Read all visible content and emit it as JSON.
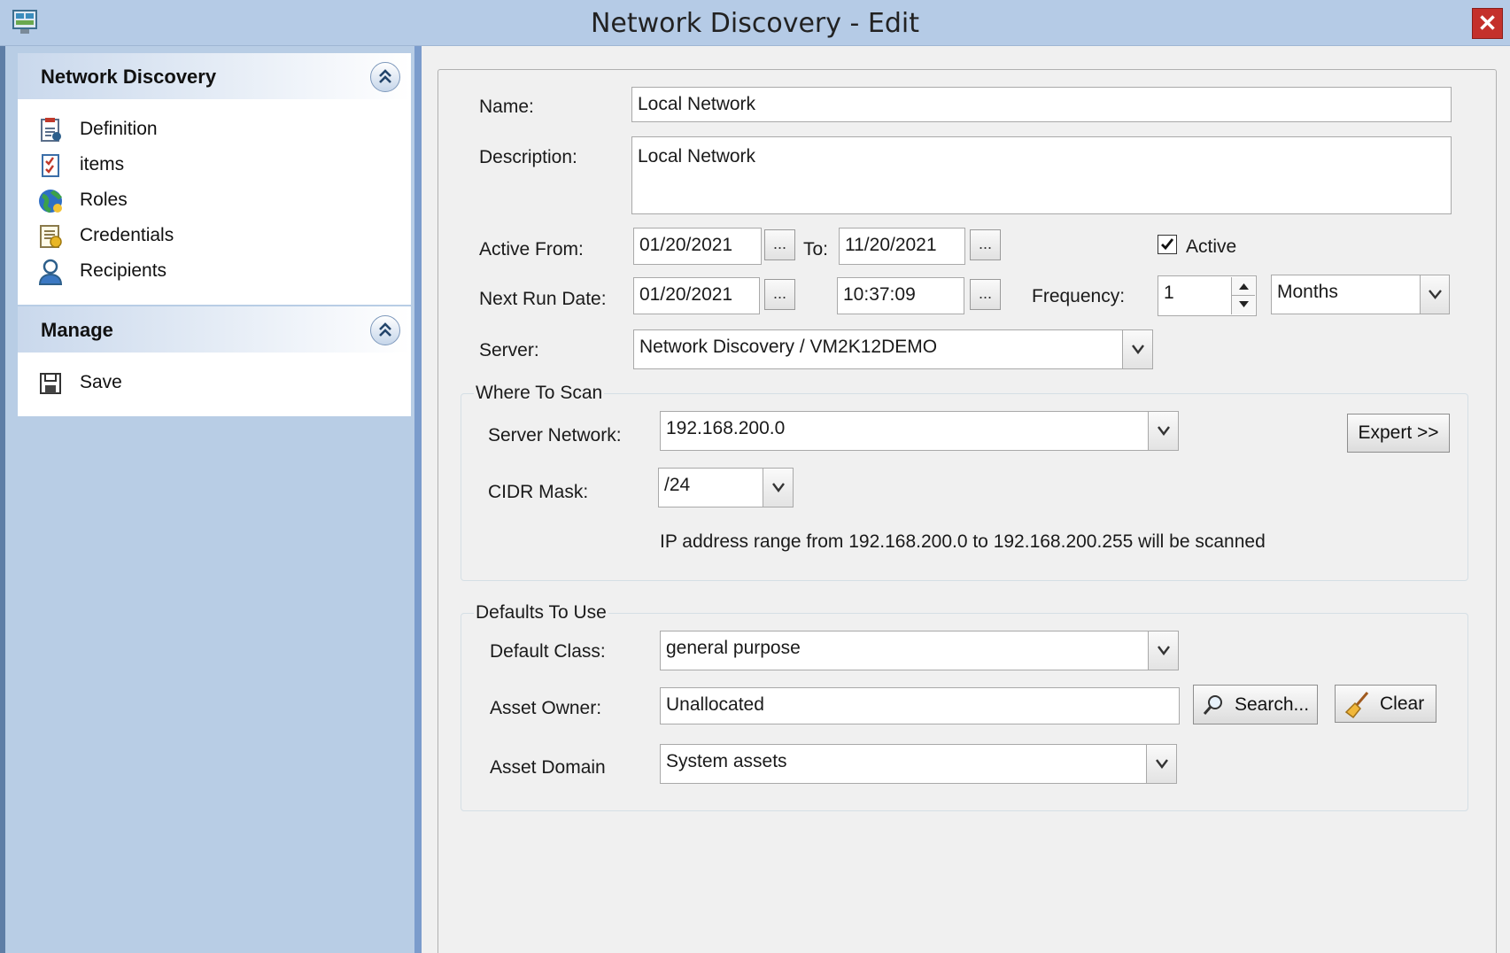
{
  "window": {
    "title": "Network Discovery - Edit",
    "close_glyph": "✕"
  },
  "sidebar": {
    "panels": [
      {
        "title": "Network Discovery",
        "items": [
          {
            "label": "Definition",
            "icon": "definition-icon"
          },
          {
            "label": "items",
            "icon": "items-checklist-icon"
          },
          {
            "label": "Roles",
            "icon": "globe-icon"
          },
          {
            "label": "Credentials",
            "icon": "credentials-certificate-icon"
          },
          {
            "label": "Recipients",
            "icon": "person-icon"
          }
        ]
      },
      {
        "title": "Manage",
        "items": [
          {
            "label": "Save",
            "icon": "floppy-disk-icon"
          }
        ]
      }
    ]
  },
  "form": {
    "name_label": "Name:",
    "name_value": "Local Network",
    "description_label": "Description:",
    "description_value": "Local Network",
    "active_from_label": "Active From:",
    "active_from_value": "01/20/2021",
    "to_label": "To:",
    "to_value": "11/20/2021",
    "ellipsis": "...",
    "active_label": "Active",
    "active_checked": true,
    "next_run_label": "Next Run Date:",
    "next_run_date": "01/20/2021",
    "next_run_time": "10:37:09",
    "frequency_label": "Frequency:",
    "frequency_value": "1",
    "frequency_unit": "Months",
    "server_label": "Server:",
    "server_value": "Network Discovery / VM2K12DEMO"
  },
  "where_to_scan": {
    "title": "Where To Scan",
    "server_network_label": "Server Network:",
    "server_network_value": "192.168.200.0",
    "expert_button": "Expert >>",
    "cidr_label": "CIDR Mask:",
    "cidr_value": "/24",
    "range_text": "IP address range from 192.168.200.0 to 192.168.200.255 will be scanned"
  },
  "defaults": {
    "title": "Defaults To Use",
    "class_label": "Default Class:",
    "class_value": "general purpose",
    "owner_label": "Asset Owner:",
    "owner_value": "Unallocated",
    "search_button": "Search...",
    "clear_button": "Clear",
    "domain_label": "Asset Domain",
    "domain_value": "System assets"
  },
  "colors": {
    "title_bar": "#b5cbe6",
    "sidebar": "#b8cde5",
    "close_button": "#c4302b",
    "content": "#f0f0f0"
  }
}
